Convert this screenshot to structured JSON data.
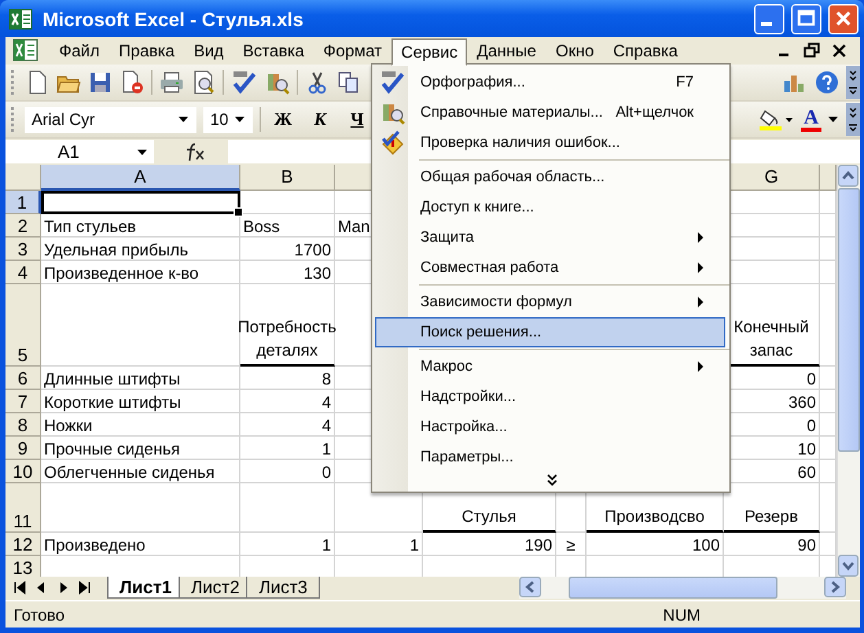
{
  "window": {
    "title": "Microsoft Excel - Стулья.xls"
  },
  "menubar": [
    {
      "label": "Файл",
      "selected": false
    },
    {
      "label": "Правка",
      "selected": false
    },
    {
      "label": "Вид",
      "selected": false
    },
    {
      "label": "Вставка",
      "selected": false
    },
    {
      "label": "Формат",
      "selected": false
    },
    {
      "label": "Сервис",
      "selected": true
    },
    {
      "label": "Данные",
      "selected": false
    },
    {
      "label": "Окно",
      "selected": false
    },
    {
      "label": "Справка",
      "selected": false
    }
  ],
  "formatting": {
    "font": "Arial Cyr",
    "size": "10",
    "bold": "Ж",
    "italic": "К",
    "underline": "Ч",
    "font_color": "A"
  },
  "formula_bar": {
    "name_box": "A1"
  },
  "sheet": {
    "columns": [
      {
        "label": "A",
        "selected": true
      },
      {
        "label": "B",
        "selected": false
      },
      null,
      null,
      null,
      null,
      {
        "label": "G",
        "selected": false
      }
    ],
    "rows": [
      {
        "number": "1",
        "selected": true,
        "cells": [
          null,
          null,
          null,
          null,
          null,
          null,
          null
        ]
      },
      {
        "number": "2",
        "selected": false,
        "cells": [
          {
            "text": "Тип стульев",
            "kind": "text"
          },
          {
            "text": "Boss",
            "kind": "text"
          },
          {
            "text": "Man",
            "kind": "text"
          },
          null,
          null,
          null,
          null
        ]
      },
      {
        "number": "3",
        "selected": false,
        "cells": [
          {
            "text": "Удельная прибыль",
            "kind": "text"
          },
          {
            "text": "1700",
            "kind": "number"
          },
          null,
          null,
          null,
          null,
          null
        ]
      },
      {
        "number": "4",
        "selected": false,
        "cells": [
          {
            "text": "Произведенное к-во",
            "kind": "text"
          },
          {
            "text": "130",
            "kind": "number"
          },
          null,
          null,
          null,
          null,
          null
        ]
      },
      {
        "number": "5",
        "selected": false,
        "cells": [
          null,
          {
            "lines": [
              "Потребность",
              "деталях"
            ],
            "kind": "heading"
          },
          null,
          null,
          null,
          null,
          {
            "lines": [
              "Конечный",
              "запас"
            ],
            "kind": "heading"
          }
        ]
      },
      {
        "number": "6",
        "selected": false,
        "cells": [
          {
            "text": "Длинные штифты",
            "kind": "text"
          },
          {
            "text": "8",
            "kind": "number"
          },
          null,
          null,
          null,
          null,
          {
            "text": "0",
            "kind": "number"
          }
        ]
      },
      {
        "number": "7",
        "selected": false,
        "cells": [
          {
            "text": "Короткие штифты",
            "kind": "text"
          },
          {
            "text": "4",
            "kind": "number"
          },
          null,
          null,
          null,
          null,
          {
            "text": "360",
            "kind": "number"
          }
        ]
      },
      {
        "number": "8",
        "selected": false,
        "cells": [
          {
            "text": "Ножки",
            "kind": "text"
          },
          {
            "text": "4",
            "kind": "number"
          },
          null,
          null,
          null,
          null,
          {
            "text": "0",
            "kind": "number"
          }
        ]
      },
      {
        "number": "9",
        "selected": false,
        "cells": [
          {
            "text": "Прочные сиденья",
            "kind": "text"
          },
          {
            "text": "1",
            "kind": "number"
          },
          null,
          null,
          null,
          null,
          {
            "text": "10",
            "kind": "number"
          }
        ]
      },
      {
        "number": "10",
        "selected": false,
        "cells": [
          {
            "text": "Облегченные сиденья",
            "kind": "text"
          },
          {
            "text": "0",
            "kind": "number"
          },
          null,
          null,
          null,
          null,
          {
            "text": "60",
            "kind": "number"
          }
        ]
      },
      {
        "number": "11",
        "selected": false,
        "cells": [
          null,
          null,
          null,
          {
            "lines": [
              "Стулья"
            ],
            "kind": "heading"
          },
          null,
          {
            "lines": [
              "Производсво"
            ],
            "kind": "heading"
          },
          {
            "lines": [
              "Резерв"
            ],
            "kind": "heading"
          }
        ]
      },
      {
        "number": "12",
        "selected": false,
        "cells": [
          {
            "text": "Произведено",
            "kind": "text"
          },
          {
            "text": "1",
            "kind": "number"
          },
          {
            "text": "1",
            "kind": "number"
          },
          {
            "text": "190",
            "kind": "number"
          },
          {
            "text": "≥",
            "kind": "symbol"
          },
          {
            "text": "100",
            "kind": "number"
          },
          {
            "text": "90",
            "kind": "number"
          }
        ]
      },
      {
        "number": "13",
        "selected": false,
        "cells": [
          null,
          null,
          null,
          null,
          null,
          null,
          null
        ]
      }
    ]
  },
  "sheet_tabs": [
    {
      "label": "Лист1",
      "selected": true
    },
    {
      "label": "Лист2",
      "selected": false
    },
    {
      "label": "Лист3",
      "selected": false
    }
  ],
  "status_bar": {
    "status": "Готово",
    "indicator": "NUM"
  },
  "dropdown_menu": [
    {
      "kind": "item",
      "label": "Орфография...",
      "shortcut": "F7",
      "submenu": false,
      "selected": false
    },
    {
      "kind": "item",
      "label": "Справочные материалы...",
      "shortcut": "Alt+щелчок",
      "submenu": false,
      "selected": false
    },
    {
      "kind": "item",
      "label": "Проверка наличия ошибок...",
      "submenu": false,
      "selected": false
    },
    {
      "kind": "separator"
    },
    {
      "kind": "item",
      "label": "Общая рабочая область...",
      "submenu": false,
      "selected": false
    },
    {
      "kind": "item",
      "label": "Доступ к книге...",
      "submenu": false,
      "selected": false
    },
    {
      "kind": "item",
      "label": "Защита",
      "submenu": true,
      "selected": false
    },
    {
      "kind": "item",
      "label": "Совместная работа",
      "submenu": true,
      "selected": false
    },
    {
      "kind": "separator"
    },
    {
      "kind": "item",
      "label": "Зависимости формул",
      "submenu": true,
      "selected": false
    },
    {
      "kind": "item",
      "label": "Поиск решения...",
      "submenu": false,
      "selected": true
    },
    {
      "kind": "separator"
    },
    {
      "kind": "item",
      "label": "Макрос",
      "submenu": true,
      "selected": false
    },
    {
      "kind": "item",
      "label": "Надстройки...",
      "submenu": false,
      "selected": false
    },
    {
      "kind": "item",
      "label": "Настройка...",
      "submenu": false,
      "selected": false
    },
    {
      "kind": "item",
      "label": "Параметры...",
      "submenu": false,
      "selected": false
    },
    {
      "kind": "more"
    }
  ]
}
